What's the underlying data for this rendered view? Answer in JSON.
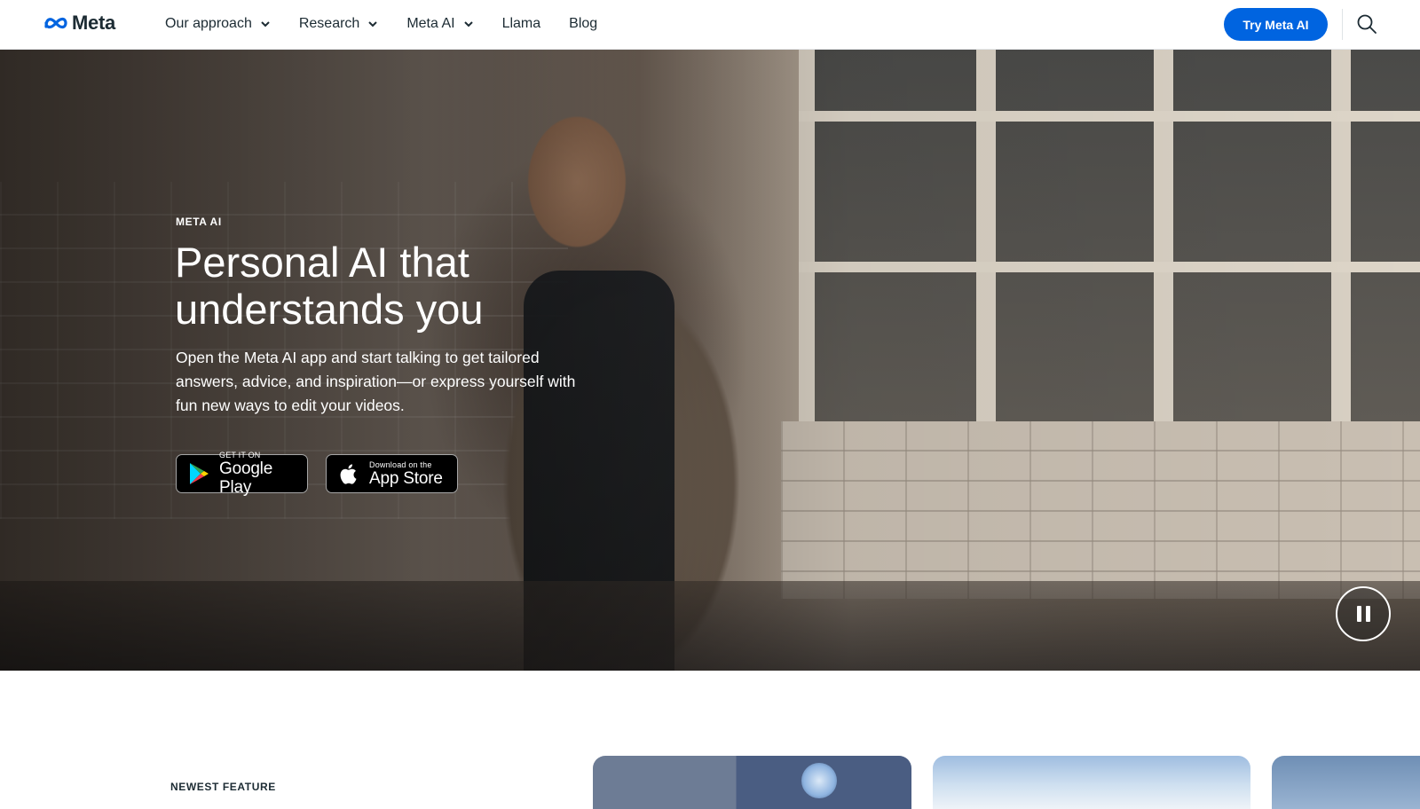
{
  "header": {
    "logo_text": "Meta",
    "nav": [
      {
        "label": "Our approach",
        "has_dropdown": true
      },
      {
        "label": "Research",
        "has_dropdown": true
      },
      {
        "label": "Meta AI",
        "has_dropdown": true
      },
      {
        "label": "Llama",
        "has_dropdown": false
      },
      {
        "label": "Blog",
        "has_dropdown": false
      }
    ],
    "cta_label": "Try Meta AI",
    "search_icon": "search-icon"
  },
  "hero": {
    "eyebrow": "META AI",
    "title": "Personal AI that understands you",
    "description": "Open the Meta AI app and start talking to get tailored answers, advice, and inspiration—or express yourself with fun new ways to edit your videos.",
    "google_play": {
      "small": "GET IT ON",
      "big": "Google Play"
    },
    "app_store": {
      "small": "Download on the",
      "big": "App Store"
    },
    "pause_icon": "pause-icon"
  },
  "section": {
    "eyebrow": "NEWEST FEATURE"
  },
  "colors": {
    "accent": "#0064e0",
    "text": "#1c2b33"
  }
}
